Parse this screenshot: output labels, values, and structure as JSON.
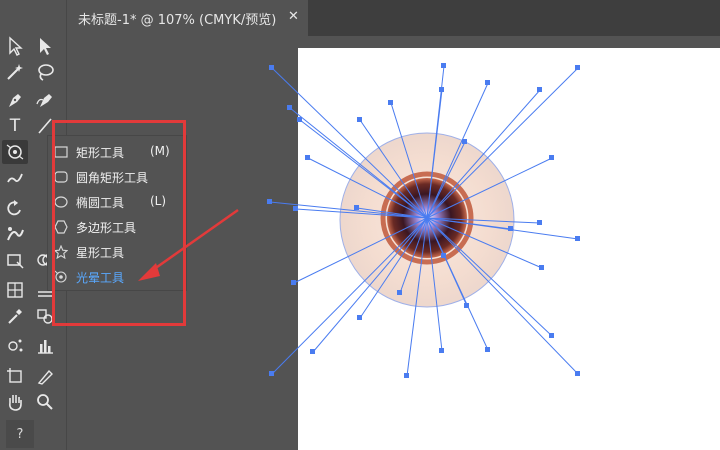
{
  "document_tab": {
    "title": "未标题-1* @ 107% (CMYK/预览)",
    "close_glyph": "✕"
  },
  "toolbar": {
    "tools": [
      {
        "name": "selection-tool",
        "icon": "arrow-outline-icon"
      },
      {
        "name": "direct-selection-tool",
        "icon": "arrow-filled-icon"
      },
      {
        "name": "magic-wand-tool",
        "icon": "magic-wand-icon"
      },
      {
        "name": "lasso-tool",
        "icon": "lasso-icon"
      },
      {
        "name": "pen-tool",
        "icon": "pen-icon"
      },
      {
        "name": "curvature-tool",
        "icon": "curvature-pen-icon"
      },
      {
        "name": "type-tool",
        "icon": "type-icon",
        "glyph": "T"
      },
      {
        "name": "line-segment-tool",
        "icon": "line-icon"
      },
      {
        "name": "shape-tool",
        "icon": "flare-icon"
      },
      {
        "name": "paintbrush-tool",
        "icon": "brush-icon"
      },
      {
        "name": "rotate-tool",
        "icon": "rotate-icon"
      },
      {
        "name": "warp-tool",
        "icon": "warp-icon"
      },
      {
        "name": "free-transform-tool",
        "icon": "free-transform-icon"
      },
      {
        "name": "shape-builder-tool",
        "icon": "shape-builder-icon"
      },
      {
        "name": "perspective-grid-tool",
        "icon": "grid-icon"
      },
      {
        "name": "mesh-tool",
        "icon": "mesh-icon"
      },
      {
        "name": "eyedropper-tool",
        "icon": "eyedropper-icon"
      },
      {
        "name": "blend-tool",
        "icon": "blend-icon"
      },
      {
        "name": "symbol-sprayer-tool",
        "icon": "symbol-sprayer-icon"
      },
      {
        "name": "column-graph-tool",
        "icon": "bar-graph-icon"
      },
      {
        "name": "artboard-tool",
        "icon": "artboard-icon"
      },
      {
        "name": "slice-tool",
        "icon": "knife-icon"
      },
      {
        "name": "hand-tool",
        "icon": "hand-icon"
      },
      {
        "name": "zoom-tool",
        "icon": "zoom-icon"
      }
    ],
    "help_glyph": "?"
  },
  "shape_flyout": {
    "items": [
      {
        "label": "矩形工具",
        "shortcut": "(M)",
        "icon": "rectangle-icon"
      },
      {
        "label": "圆角矩形工具",
        "shortcut": "",
        "icon": "rounded-rectangle-icon"
      },
      {
        "label": "椭圆工具",
        "shortcut": "(L)",
        "icon": "ellipse-icon"
      },
      {
        "label": "多边形工具",
        "shortcut": "",
        "icon": "polygon-icon"
      },
      {
        "label": "星形工具",
        "shortcut": "",
        "icon": "star-icon"
      },
      {
        "label": "光晕工具",
        "shortcut": "",
        "icon": "flare-icon",
        "selected": true
      }
    ]
  },
  "colors": {
    "annotation_red": "#e23a3a",
    "selection_blue": "#4a7cf0",
    "selected_item_text": "#5aa9ff",
    "flare_center": "#5a1a20",
    "flare_halo": "#f5dcd0"
  }
}
